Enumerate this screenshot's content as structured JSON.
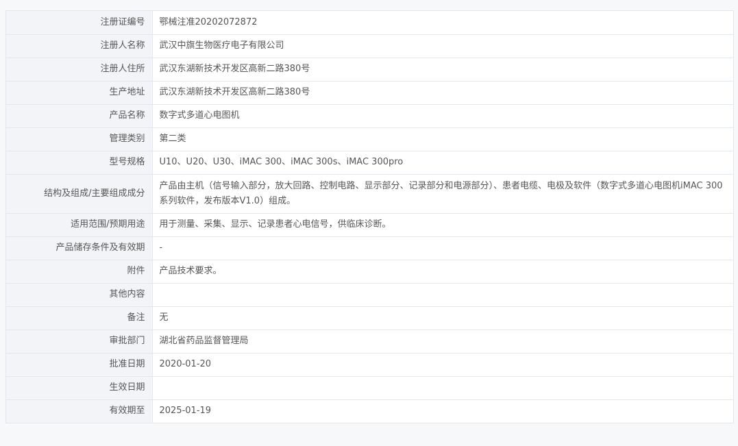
{
  "rows": [
    {
      "label": "注册证编号",
      "value": "鄂械注准20202072872"
    },
    {
      "label": "注册人名称",
      "value": "武汉中旗生物医疗电子有限公司"
    },
    {
      "label": "注册人住所",
      "value": "武汉东湖新技术开发区高新二路380号"
    },
    {
      "label": "生产地址",
      "value": "武汉东湖新技术开发区高新二路380号"
    },
    {
      "label": "产品名称",
      "value": "数字式多道心电图机"
    },
    {
      "label": "管理类别",
      "value": "第二类"
    },
    {
      "label": "型号规格",
      "value": "U10、U20、U30、iMAC 300、iMAC 300s、iMAC 300pro"
    },
    {
      "label": "结构及组成/主要组成成分",
      "value": "产品由主机（信号输入部分，放大回路、控制电路、显示部分、记录部分和电源部分）、患者电缆、电极及软件（数字式多道心电图机iMAC 300系列软件，发布版本V1.0）组成。"
    },
    {
      "label": "适用范围/预期用途",
      "value": "用于测量、采集、显示、记录患者心电信号，供临床诊断。"
    },
    {
      "label": "产品储存条件及有效期",
      "value": "-"
    },
    {
      "label": "附件",
      "value": "产品技术要求。"
    },
    {
      "label": "其他内容",
      "value": ""
    },
    {
      "label": "备注",
      "value": "无"
    },
    {
      "label": "审批部门",
      "value": "湖北省药品监督管理局"
    },
    {
      "label": "批准日期",
      "value": "2020-01-20"
    },
    {
      "label": "生效日期",
      "value": ""
    },
    {
      "label": "有效期至",
      "value": "2025-01-19"
    }
  ]
}
